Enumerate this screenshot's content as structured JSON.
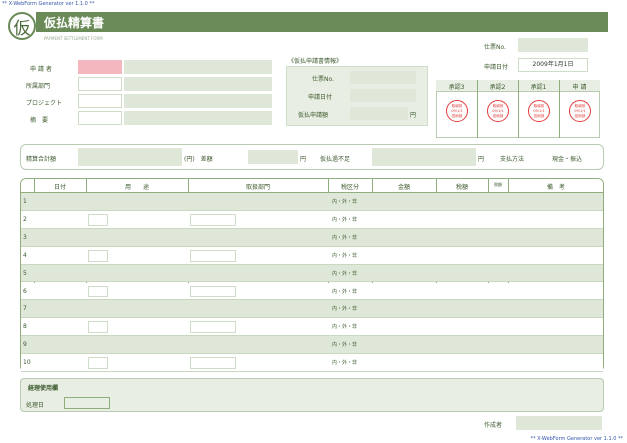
{
  "header": {
    "tiny_top_left": "** X-WebForm Generator ver 1.1.0 **",
    "tiny_bottom_right": "** X-WebForm Generator ver 1.1.0 **",
    "logo_char": "仮",
    "title": "仮払精算書",
    "subtitle": "PAYMENT SETTLEMENT FORM",
    "doc_no_label": "仕票No.",
    "date_label": "申請日付",
    "date_value": "2009年1月1日"
  },
  "applicant": {
    "fields": [
      "申 請 者",
      "所属部門",
      "プロジェクト",
      "摘　要"
    ]
  },
  "prepay_info": {
    "title": "《仮払申請書情報》",
    "fields": [
      "仕票No.",
      "申請日付",
      "仮払申請額"
    ],
    "unit": "円"
  },
  "approval": {
    "headers": [
      "承認3",
      "承認2",
      "承認1",
      "申 請"
    ],
    "stamp_lines": [
      "取締役",
      "09/1/1",
      "技術部"
    ]
  },
  "summary": {
    "settle_total_label": "精算合計額",
    "yen": "円",
    "diff_label": "(円)　差額",
    "pay_label": "仮払過不足",
    "method_label": "支払方法",
    "method_value": "現金・振込"
  },
  "table": {
    "headers": [
      "",
      "日付",
      "用　　途",
      "取扱部門",
      "税区分",
      "金額",
      "税額",
      "税額",
      "備　考"
    ],
    "tax_option": "内・外・非",
    "rows": [
      "1",
      "2",
      "3",
      "4",
      "5",
      "6",
      "7",
      "8",
      "9",
      "10"
    ]
  },
  "footer": {
    "label": "経理使用欄",
    "sub_label": "処理日",
    "creator_label": "作成者"
  }
}
